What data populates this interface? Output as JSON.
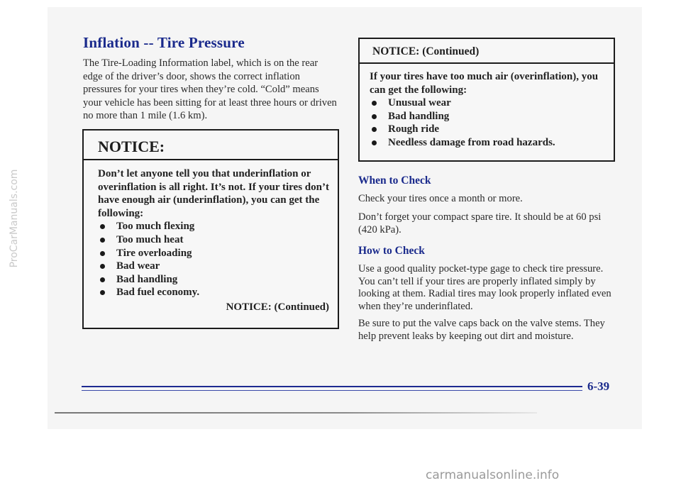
{
  "section": {
    "title": "Inflation -- Tire Pressure",
    "intro": "The Tire-Loading Information label, which is on the rear edge of the driver’s door, shows the correct inflation pressures for your tires when they’re cold. “Cold” means your vehicle has been sitting for at least three hours or driven no more than 1 mile (1.6 km)."
  },
  "notice_left": {
    "header": "NOTICE:",
    "body": "Don’t let anyone tell you that underinflation or overinflation is all right. It’s not. If your tires don’t have enough air (underinflation), you can get the following:",
    "items": [
      "Too much flexing",
      "Too much heat",
      "Tire overloading",
      "Bad wear",
      "Bad handling",
      "Bad fuel economy."
    ],
    "continued": "NOTICE: (Continued)"
  },
  "notice_right": {
    "header": "NOTICE: (Continued)",
    "body": "If your tires have too much air (overinflation), you can get the following:",
    "items": [
      "Unusual wear",
      "Bad handling",
      "Rough ride",
      "Needless damage from road hazards."
    ]
  },
  "when_to_check": {
    "heading": "When to Check",
    "paragraphs": [
      "Check your tires once a month or more.",
      "Don’t forget your compact spare tire. It should be at 60 psi (420 kPa)."
    ]
  },
  "how_to_check": {
    "heading": "How to Check",
    "paragraphs": [
      "Use a good quality pocket-type gage to check tire pressure. You can’t tell if your tires are properly inflated simply by looking at them. Radial tires may look properly inflated even when they’re underinflated.",
      "Be sure to put the valve caps back on the valve stems. They help prevent leaks by keeping out dirt and moisture."
    ]
  },
  "page_number": "6-39",
  "watermarks": {
    "left": "ProCarManuals.com",
    "bottom": "carmanualsonline.info"
  },
  "colors": {
    "heading_blue": "#1a2a8c",
    "page_bg": "#f5f5f5"
  }
}
